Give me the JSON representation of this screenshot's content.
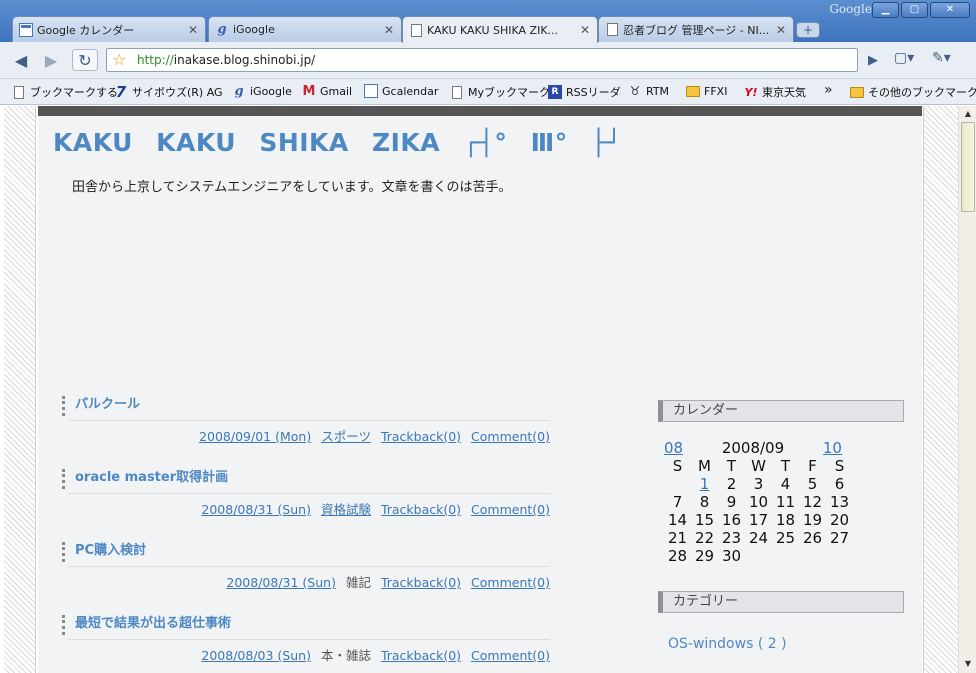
{
  "window": {
    "brand": "Google",
    "buttons": {
      "minimize": "▁",
      "maximize": "▢",
      "close": "✕"
    },
    "accent_color": "#3f74bd"
  },
  "tabs": [
    {
      "label": "Google カレンダー",
      "icon": "calendar-icon",
      "active": false
    },
    {
      "label": "iGoogle",
      "icon": "igoogle-icon",
      "active": false
    },
    {
      "label": "KAKU KAKU SHIKA ZIK...",
      "icon": "page-icon",
      "active": true
    },
    {
      "label": "忍者ブログ 管理ページ - NI...",
      "icon": "page-icon",
      "active": false
    }
  ],
  "toolbar": {
    "url_scheme": "http://",
    "url_rest": "inakase.blog.shinobi.jp/"
  },
  "bookmarks": [
    {
      "label": "ブックマークする",
      "icon": "page-icon"
    },
    {
      "label": "サイボウズ(R) AG",
      "icon": "cybozu-icon"
    },
    {
      "label": "iGoogle",
      "icon": "igoogle-icon"
    },
    {
      "label": "Gmail",
      "icon": "gmail-icon"
    },
    {
      "label": "Gcalendar",
      "icon": "calendar-icon"
    },
    {
      "label": "Myブックマーク",
      "icon": "page-icon"
    },
    {
      "label": "RSSリーダ",
      "icon": "rss-reader-icon"
    },
    {
      "label": "RTM",
      "icon": "rtm-cow-icon"
    },
    {
      "label": "FFXI",
      "icon": "folder-icon"
    },
    {
      "label": "東京天気",
      "icon": "yahoo-icon"
    },
    {
      "label": "その他のブックマーク",
      "icon": "folder-icon"
    }
  ],
  "blog": {
    "title": "KAKU KAKU SHIKA ZIKA ┌┤° Ⅲ° ├┘",
    "description": "田舎から上京してシステムエンジニアをしています。文章を書くのは苦手。",
    "posts": [
      {
        "title": "パルクール",
        "date": "2008/09/01 (Mon)",
        "category": "スポーツ",
        "category_link": true,
        "trackback": "Trackback(0)",
        "comment": "Comment(0)"
      },
      {
        "title": "oracle master取得計画",
        "date": "2008/08/31 (Sun)",
        "category": "資格試験",
        "category_link": true,
        "trackback": "Trackback(0)",
        "comment": "Comment(0)"
      },
      {
        "title": "PC購入検討",
        "date": "2008/08/31 (Sun)",
        "category": "雑記",
        "category_link": false,
        "trackback": "Trackback(0)",
        "comment": "Comment(0)"
      },
      {
        "title": "最短で結果が出る超仕事術",
        "date": "2008/08/03 (Sun)",
        "category": "本・雑誌",
        "category_link": false,
        "trackback": "Trackback(0)",
        "comment": "Comment(0)"
      }
    ],
    "sidebar": {
      "calendar_heading": "カレンダー",
      "calendar": {
        "prev": "08",
        "month": "2008/09",
        "next": "10",
        "weekdays": [
          "S",
          "M",
          "T",
          "W",
          "T",
          "F",
          "S"
        ],
        "weeks": [
          [
            "",
            "1",
            "2",
            "3",
            "4",
            "5",
            "6"
          ],
          [
            "7",
            "8",
            "9",
            "10",
            "11",
            "12",
            "13"
          ],
          [
            "14",
            "15",
            "16",
            "17",
            "18",
            "19",
            "20"
          ],
          [
            "21",
            "22",
            "23",
            "24",
            "25",
            "26",
            "27"
          ],
          [
            "28",
            "29",
            "30",
            "",
            "",
            "",
            ""
          ]
        ],
        "linked_day": "1"
      },
      "category_heading": "カテゴリー",
      "categories": [
        "OS-windows ( 2 )"
      ]
    },
    "link_color": "#3b78b8",
    "title_color": "#4e88c4"
  }
}
